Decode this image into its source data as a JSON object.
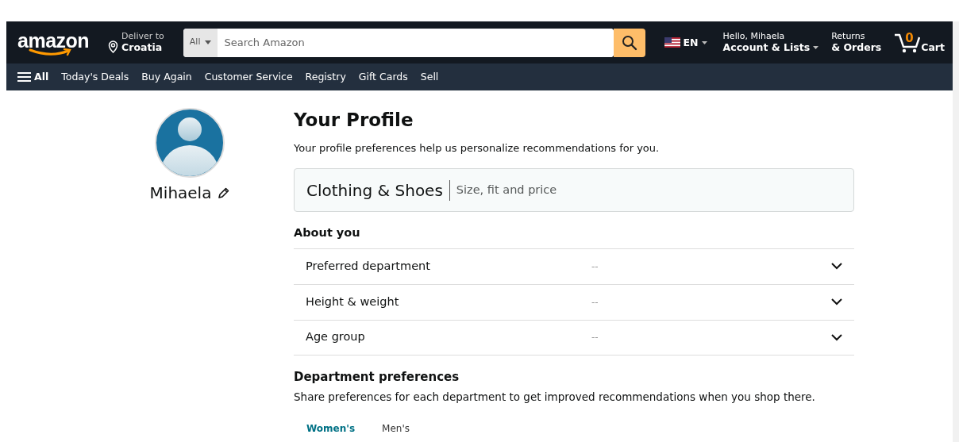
{
  "header": {
    "logo": "amazon",
    "deliver_label": "Deliver to",
    "deliver_location": "Croatia",
    "search_category": "All",
    "search_placeholder": "Search Amazon",
    "language": "EN",
    "greeting": "Hello, Mihaela",
    "account": "Account & Lists",
    "returns": "Returns",
    "orders": "& Orders",
    "cart_count": "0",
    "cart": "Cart"
  },
  "subnav": {
    "menu": "All",
    "links": [
      "Today's Deals",
      "Buy Again",
      "Customer Service",
      "Registry",
      "Gift Cards",
      "Sell"
    ]
  },
  "profile": {
    "name": "Mihaela"
  },
  "main": {
    "title": "Your Profile",
    "intro": "Your profile preferences help us personalize recommendations for you.",
    "category": {
      "title": "Clothing & Shoes",
      "subtitle": "Size, fit and price"
    },
    "about_heading": "About you",
    "about_rows": [
      {
        "label": "Preferred department",
        "value": "--",
        "expanded": false
      },
      {
        "label": "Height & weight",
        "value": "--",
        "expanded": false
      },
      {
        "label": "Age group",
        "value": "--",
        "expanded": false
      }
    ],
    "dept_heading": "Department preferences",
    "dept_text": "Share preferences for each department to get improved recommendations when you shop there.",
    "dept_tabs": [
      {
        "label": "Women's",
        "selected": true
      },
      {
        "label": "Men's",
        "selected": false
      }
    ]
  }
}
